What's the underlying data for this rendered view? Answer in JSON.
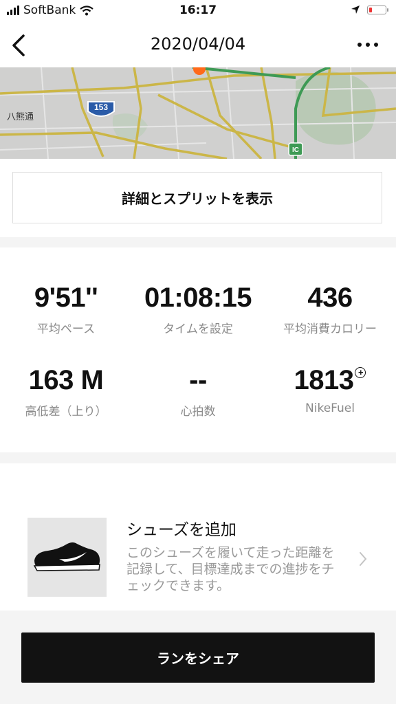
{
  "status_bar": {
    "carrier": "SoftBank",
    "time": "16:17"
  },
  "header": {
    "title": "2020/04/04",
    "back_icon": "chevron-left-icon",
    "more_icon": "more-horizontal-icon"
  },
  "map": {
    "road_number": "153",
    "place_label": "八熊通",
    "interchange_badge": "IC",
    "route_color": "#ff6a1a"
  },
  "detail_button": {
    "label": "詳細とスプリットを表示"
  },
  "stats": [
    {
      "value": "9'51''",
      "label": "平均ペース"
    },
    {
      "value": "01:08:15",
      "label": "タイムを設定"
    },
    {
      "value": "436",
      "label": "平均消費カロリー"
    },
    {
      "value": "163 M",
      "label": "高低差（上り）"
    },
    {
      "value": "--",
      "label": "心拍数"
    },
    {
      "value": "1813",
      "label": "NikeFuel"
    }
  ],
  "shoe": {
    "title": "シューズを追加",
    "description": "このシューズを履いて走った距離を記録して、目標達成までの進捗をチェックできます。"
  },
  "share_button": {
    "label": "ランをシェア"
  },
  "colors": {
    "background": "#f4f4f4",
    "card": "#ffffff",
    "button_dark": "#121212",
    "muted_text": "#8a8a8a"
  }
}
